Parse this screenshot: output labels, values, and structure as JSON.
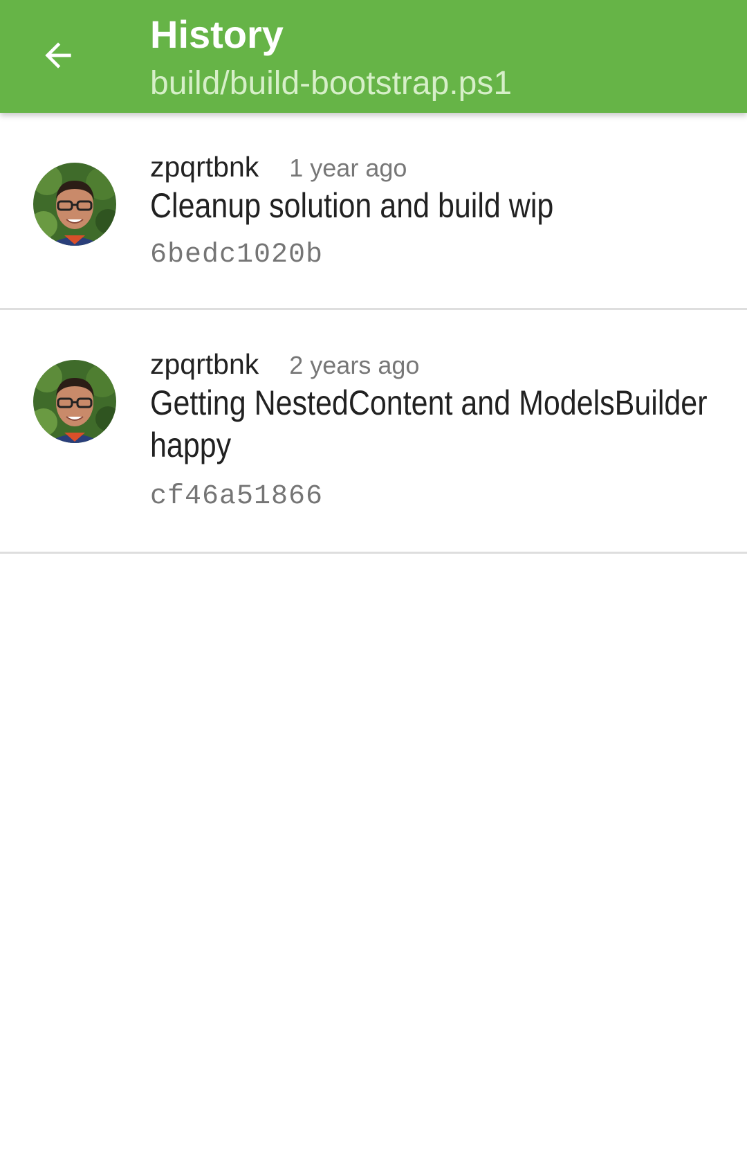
{
  "appbar": {
    "title": "History",
    "subtitle": "build/build-bootstrap.ps1",
    "back_icon": "arrow-left-icon",
    "color": "#66b447"
  },
  "commits": [
    {
      "author": "zpqrtbnk",
      "time": "1 year ago",
      "message": "Cleanup solution and build wip",
      "sha": "6bedc1020b",
      "avatar_icon": "avatar-photo"
    },
    {
      "author": "zpqrtbnk",
      "time": "2 years ago",
      "message": "Getting NestedContent and ModelsBuilder happy",
      "sha": "cf46a51866",
      "avatar_icon": "avatar-photo"
    }
  ]
}
